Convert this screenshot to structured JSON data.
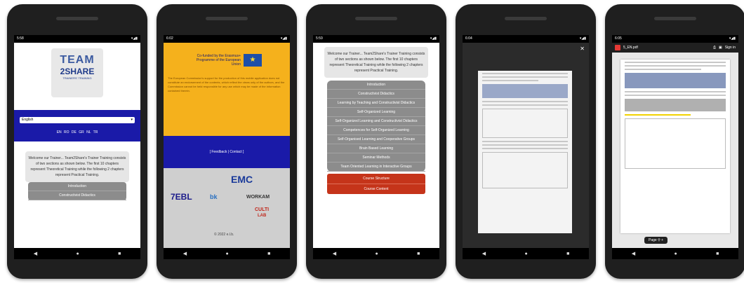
{
  "status": {
    "p1_time": "5:58",
    "p2_time": "6:02",
    "p3_time": "5:59",
    "p4_time": "6:04",
    "p5_time": "6:05",
    "icons_right": "▾◢▮"
  },
  "nav": {
    "back": "◀",
    "home": "●",
    "recents": "■"
  },
  "phone1": {
    "logo_top": "TEAM",
    "logo_mid": "2SHARE",
    "logo_sub": "TRAINERS' TRAINING",
    "language_select": "English",
    "languages": "EN  RO  DE  GR  NL  TR",
    "welcome_text": "Welcome our Trainer... Team2Share's Trainer Training consists of two sections as shown below. The first 10 chapters represent Theoretical Training while the following 2 chapters represent Practical Training.",
    "menu": [
      "Introduction",
      "Constructivist Didactics"
    ]
  },
  "phone2": {
    "eu_text": "Co-funded by the Erasmus+ Programme of the European Union",
    "disclaimer": "The European Commission's support for the production of this mobile application does not constitute an endorsement of the contents, which reflect the views only of the authors, and the Commission cannot be held responsible for any use which may be made of the information contained therein.",
    "links": "[ Feedback | Contact ]",
    "logos": [
      "EMC",
      "7EBL",
      "bk",
      "WORKAM",
      "CULTI",
      "LAB"
    ],
    "copyright": "© 2022 e.l.b."
  },
  "phone3": {
    "welcome_text": "Welcome our Trainer... Team2Share's Trainer Training consists of two sections as shown below. The first 10 chapters represent Theoretical Training while the following 2 chapters represent Practical Training.",
    "menu": [
      "Introduction",
      "Constructivist Didactics",
      "Learning by Teaching and Constructivist Didactics",
      "Self-Organized Learning",
      "Self-Organized Learning and Constructivist Didactics",
      "Competences for Self-Organized Learning",
      "Self-Organised Learning and Cooperative Groups",
      "Brain Based Learning",
      "Seminar Methods",
      "Team Oriented Learning in Interactive Groups"
    ],
    "buttons": [
      "Course Structure",
      "Course Content"
    ]
  },
  "phone4": {
    "close": "✕"
  },
  "phone5": {
    "filename": "5_EN.pdf",
    "sign_in": "Sign in",
    "page_label": "Page"
  }
}
